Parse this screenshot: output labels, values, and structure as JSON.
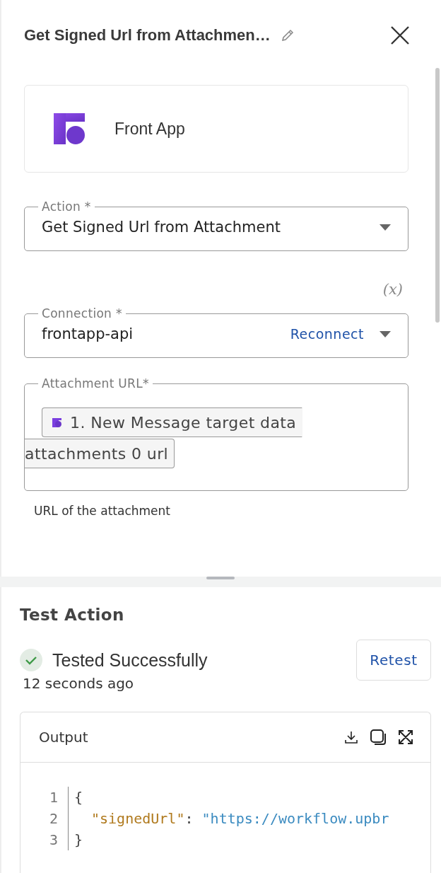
{
  "header": {
    "title": "Get Signed Url from Attachmen…"
  },
  "app": {
    "name": "Front App"
  },
  "fields": [
    {
      "kind": "select",
      "label": "Action *",
      "value": "Get Signed Url from Attachment"
    },
    {
      "kind": "select",
      "label": "Connection *",
      "value": "frontapp-api",
      "action": "Reconnect",
      "toggle": "(x)"
    },
    {
      "kind": "tokens",
      "label": "Attachment URL*",
      "tokens": [
        "1. New Message target data",
        "attachments 0 url"
      ],
      "help": "URL of the attachment"
    }
  ],
  "test": {
    "title": "Test Action",
    "status": "Tested Successfully",
    "time": "12 seconds ago",
    "button": "Retest"
  },
  "output": {
    "title": "Output",
    "lines": [
      {
        "number": "1",
        "parts": [
          {
            "kind": "punct",
            "text": "{"
          }
        ]
      },
      {
        "number": "2",
        "parts": [
          {
            "kind": "indent"
          },
          {
            "kind": "key",
            "text": "\"signedUrl\""
          },
          {
            "kind": "punct",
            "text": ": "
          },
          {
            "kind": "string",
            "text": "\"https://workflow.upbr"
          }
        ]
      },
      {
        "number": "3",
        "parts": [
          {
            "kind": "punct",
            "text": "}"
          }
        ]
      }
    ]
  }
}
